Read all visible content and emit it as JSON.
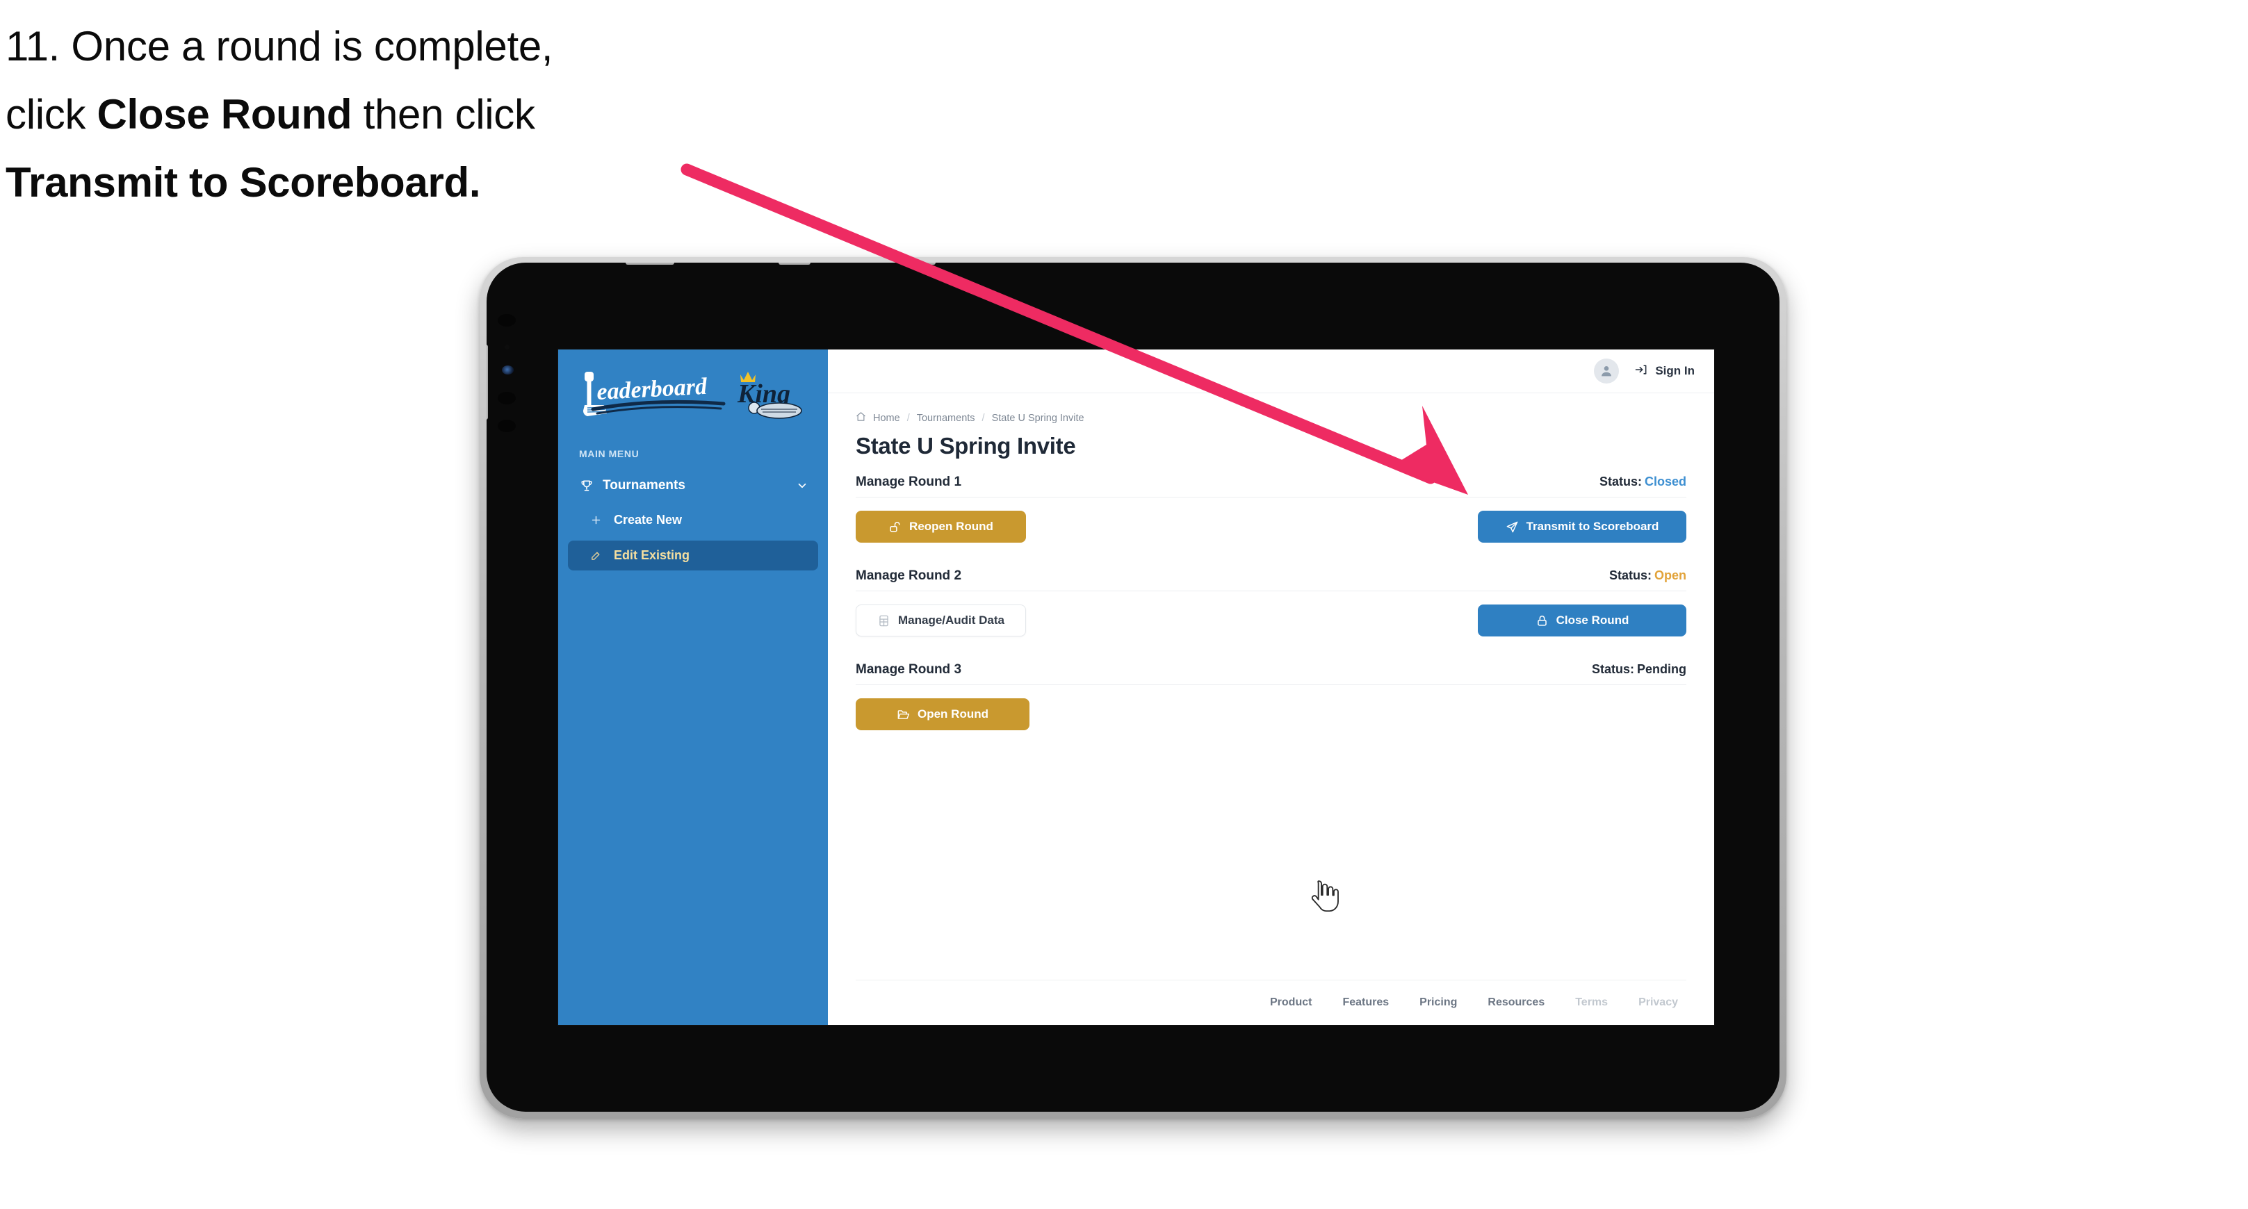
{
  "caption": {
    "line1_prefix": "11. Once a round is complete,",
    "line2_prefix": "click ",
    "line2_bold": "Close Round",
    "line2_suffix": " then click",
    "line3_bold": "Transmit to Scoreboard."
  },
  "colors": {
    "arrow": "#EE2B62",
    "sidebar_bg": "#3182C4",
    "sidebar_active_bg": "#1F6099",
    "sidebar_active_text": "#F5DFA0",
    "gold_button": "#C9992F",
    "blue_button": "#2F80C2",
    "status_closed": "#3D8FD1",
    "status_open": "#E2A33A",
    "status_pending": "#222B38",
    "title_text": "#1F2937",
    "device_frame": "#B9B9B9",
    "device_bezel": "#0A0A0A"
  },
  "sidebar": {
    "logo_word1": "Leaderboard",
    "logo_word2": "King",
    "menu_label": "MAIN MENU",
    "items": [
      {
        "label": "Tournaments",
        "icon": "trophy-icon",
        "chevron": "chevron-down-icon",
        "active": false
      },
      {
        "label": "Create New",
        "icon": "plus-icon",
        "active": false
      },
      {
        "label": "Edit Existing",
        "icon": "pencil-square-icon",
        "active": true
      }
    ]
  },
  "topbar": {
    "avatar_icon": "user-avatar-icon",
    "signin_icon": "sign-in-arrow-icon",
    "signin_label": "Sign In"
  },
  "breadcrumb": {
    "home_icon": "home-icon",
    "items": [
      "Home",
      "Tournaments",
      "State U Spring Invite"
    ],
    "separator": "/"
  },
  "page": {
    "title": "State U Spring Invite"
  },
  "rounds": [
    {
      "title": "Manage Round 1",
      "status_label": "Status:",
      "status_value": "Closed",
      "status_color": "#3D8FD1",
      "left_button": {
        "label": "Reopen Round",
        "icon": "unlock-icon",
        "style": "gold"
      },
      "right_button": {
        "label": "Transmit to Scoreboard",
        "icon": "paper-plane-icon",
        "style": "blue"
      }
    },
    {
      "title": "Manage Round 2",
      "status_label": "Status:",
      "status_value": "Open",
      "status_color": "#E2A33A",
      "left_button": {
        "label": "Manage/Audit Data",
        "icon": "table-grid-icon",
        "style": "ghost"
      },
      "right_button": {
        "label": "Close Round",
        "icon": "lock-icon",
        "style": "blue"
      }
    },
    {
      "title": "Manage Round 3",
      "status_label": "Status:",
      "status_value": "Pending",
      "status_color": "#222B38",
      "left_button": {
        "label": "Open Round",
        "icon": "folder-open-icon",
        "style": "gold"
      },
      "right_button": null
    }
  ],
  "footer": {
    "links": [
      {
        "label": "Product",
        "dim": false
      },
      {
        "label": "Features",
        "dim": false
      },
      {
        "label": "Pricing",
        "dim": false
      },
      {
        "label": "Resources",
        "dim": false
      },
      {
        "label": "Terms",
        "dim": true
      },
      {
        "label": "Privacy",
        "dim": true
      }
    ]
  },
  "cursor": {
    "icon": "pointing-hand-cursor"
  }
}
